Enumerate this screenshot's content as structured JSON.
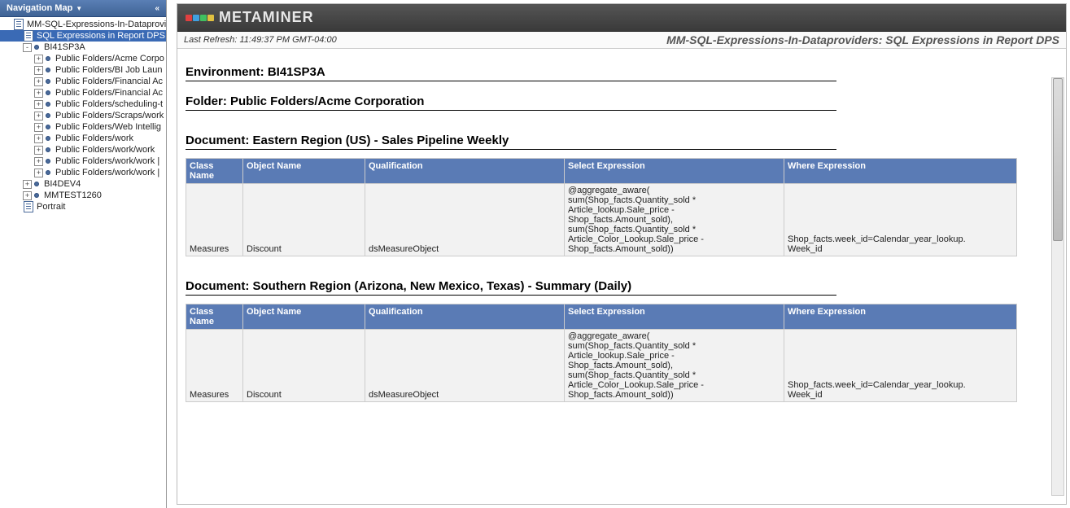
{
  "sidebar": {
    "title": "Navigation Map",
    "items": [
      {
        "indent": 0,
        "expander": "",
        "icon": "doc",
        "label": "MM-SQL-Expressions-In-Dataprovider",
        "selected": false
      },
      {
        "indent": 1,
        "expander": "",
        "icon": "doc",
        "label": "SQL Expressions in Report DPS",
        "selected": true
      },
      {
        "indent": 2,
        "expander": "-",
        "icon": "bullet",
        "label": "BI41SP3A",
        "selected": false
      },
      {
        "indent": 3,
        "expander": "+",
        "icon": "bullet",
        "label": "Public Folders/Acme Corpo",
        "selected": false
      },
      {
        "indent": 3,
        "expander": "+",
        "icon": "bullet",
        "label": "Public Folders/BI Job Laun",
        "selected": false
      },
      {
        "indent": 3,
        "expander": "+",
        "icon": "bullet",
        "label": "Public Folders/Financial Ac",
        "selected": false
      },
      {
        "indent": 3,
        "expander": "+",
        "icon": "bullet",
        "label": "Public Folders/Financial Ac",
        "selected": false
      },
      {
        "indent": 3,
        "expander": "+",
        "icon": "bullet",
        "label": "Public Folders/scheduling-t",
        "selected": false
      },
      {
        "indent": 3,
        "expander": "+",
        "icon": "bullet",
        "label": "Public Folders/Scraps/work",
        "selected": false
      },
      {
        "indent": 3,
        "expander": "+",
        "icon": "bullet",
        "label": "Public Folders/Web Intellig",
        "selected": false
      },
      {
        "indent": 3,
        "expander": "+",
        "icon": "bullet",
        "label": "Public Folders/work",
        "selected": false
      },
      {
        "indent": 3,
        "expander": "+",
        "icon": "bullet",
        "label": "Public Folders/work/work",
        "selected": false
      },
      {
        "indent": 3,
        "expander": "+",
        "icon": "bullet",
        "label": "Public Folders/work/work |",
        "selected": false
      },
      {
        "indent": 3,
        "expander": "+",
        "icon": "bullet",
        "label": "Public Folders/work/work |",
        "selected": false
      },
      {
        "indent": 2,
        "expander": "+",
        "icon": "bullet",
        "label": "BI4DEV4",
        "selected": false
      },
      {
        "indent": 2,
        "expander": "+",
        "icon": "bullet",
        "label": "MMTEST1260",
        "selected": false
      },
      {
        "indent": 1,
        "expander": "",
        "icon": "doc",
        "label": "Portrait",
        "selected": false
      }
    ]
  },
  "brand": "METAMINER",
  "logo_colors": [
    "#e04040",
    "#40a0e0",
    "#40c060",
    "#e0c040"
  ],
  "last_refresh_label": "Last Refresh: 11:49:37 PM GMT-04:00",
  "report_title": "MM-SQL-Expressions-In-Dataproviders: SQL Expressions in  Report DPS",
  "env_heading": "Environment: BI41SP3A",
  "folder_heading": "Folder: Public Folders/Acme Corporation",
  "tables": {
    "headers": {
      "class_name": "Class Name",
      "object_name": "Object Name",
      "qualification": "Qualification",
      "select_expr": "Select Expression",
      "where_expr": "Where Expression"
    }
  },
  "documents": [
    {
      "title": "Document: Eastern Region (US) - Sales Pipeline Weekly",
      "row": {
        "class_name": "Measures",
        "object_name": "Discount",
        "qualification": "dsMeasureObject",
        "select_expr": "@aggregate_aware(\nsum(Shop_facts.Quantity_sold *\nArticle_lookup.Sale_price -\nShop_facts.Amount_sold),\nsum(Shop_facts.Quantity_sold *\nArticle_Color_Lookup.Sale_price -\nShop_facts.Amount_sold))",
        "where_expr": "Shop_facts.week_id=Calendar_year_lookup.\nWeek_id"
      }
    },
    {
      "title": "Document: Southern Region (Arizona, New Mexico, Texas) - Summary (Daily)",
      "row": {
        "class_name": "Measures",
        "object_name": "Discount",
        "qualification": "dsMeasureObject",
        "select_expr": "@aggregate_aware(\nsum(Shop_facts.Quantity_sold *\nArticle_lookup.Sale_price -\nShop_facts.Amount_sold),\nsum(Shop_facts.Quantity_sold *\nArticle_Color_Lookup.Sale_price -\nShop_facts.Amount_sold))",
        "where_expr": "Shop_facts.week_id=Calendar_year_lookup.\nWeek_id"
      }
    }
  ]
}
